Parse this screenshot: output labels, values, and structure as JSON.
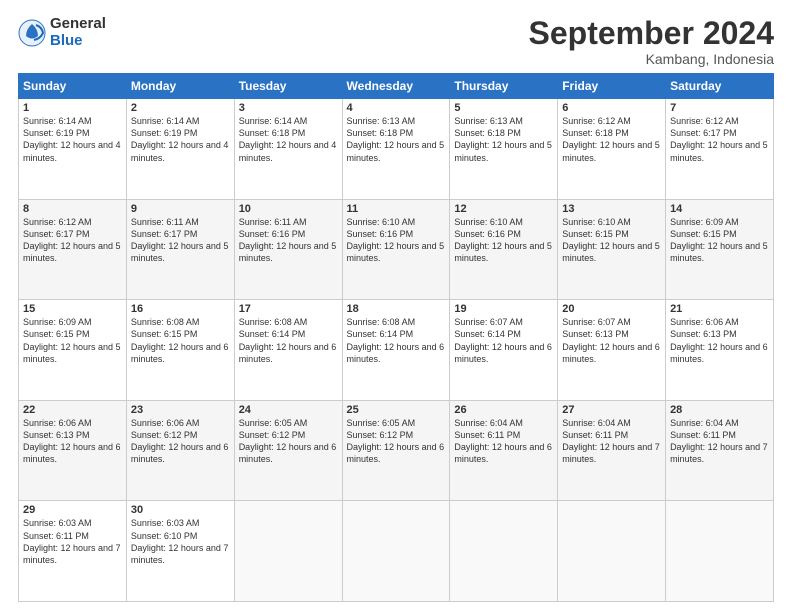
{
  "logo": {
    "general": "General",
    "blue": "Blue"
  },
  "title": "September 2024",
  "location": "Kambang, Indonesia",
  "days_header": [
    "Sunday",
    "Monday",
    "Tuesday",
    "Wednesday",
    "Thursday",
    "Friday",
    "Saturday"
  ],
  "weeks": [
    [
      {
        "day": "1",
        "sunrise": "6:14 AM",
        "sunset": "6:19 PM",
        "daylight": "12 hours and 4 minutes."
      },
      {
        "day": "2",
        "sunrise": "6:14 AM",
        "sunset": "6:19 PM",
        "daylight": "12 hours and 4 minutes."
      },
      {
        "day": "3",
        "sunrise": "6:14 AM",
        "sunset": "6:18 PM",
        "daylight": "12 hours and 4 minutes."
      },
      {
        "day": "4",
        "sunrise": "6:13 AM",
        "sunset": "6:18 PM",
        "daylight": "12 hours and 5 minutes."
      },
      {
        "day": "5",
        "sunrise": "6:13 AM",
        "sunset": "6:18 PM",
        "daylight": "12 hours and 5 minutes."
      },
      {
        "day": "6",
        "sunrise": "6:12 AM",
        "sunset": "6:18 PM",
        "daylight": "12 hours and 5 minutes."
      },
      {
        "day": "7",
        "sunrise": "6:12 AM",
        "sunset": "6:17 PM",
        "daylight": "12 hours and 5 minutes."
      }
    ],
    [
      {
        "day": "8",
        "sunrise": "6:12 AM",
        "sunset": "6:17 PM",
        "daylight": "12 hours and 5 minutes."
      },
      {
        "day": "9",
        "sunrise": "6:11 AM",
        "sunset": "6:17 PM",
        "daylight": "12 hours and 5 minutes."
      },
      {
        "day": "10",
        "sunrise": "6:11 AM",
        "sunset": "6:16 PM",
        "daylight": "12 hours and 5 minutes."
      },
      {
        "day": "11",
        "sunrise": "6:10 AM",
        "sunset": "6:16 PM",
        "daylight": "12 hours and 5 minutes."
      },
      {
        "day": "12",
        "sunrise": "6:10 AM",
        "sunset": "6:16 PM",
        "daylight": "12 hours and 5 minutes."
      },
      {
        "day": "13",
        "sunrise": "6:10 AM",
        "sunset": "6:15 PM",
        "daylight": "12 hours and 5 minutes."
      },
      {
        "day": "14",
        "sunrise": "6:09 AM",
        "sunset": "6:15 PM",
        "daylight": "12 hours and 5 minutes."
      }
    ],
    [
      {
        "day": "15",
        "sunrise": "6:09 AM",
        "sunset": "6:15 PM",
        "daylight": "12 hours and 5 minutes."
      },
      {
        "day": "16",
        "sunrise": "6:08 AM",
        "sunset": "6:15 PM",
        "daylight": "12 hours and 6 minutes."
      },
      {
        "day": "17",
        "sunrise": "6:08 AM",
        "sunset": "6:14 PM",
        "daylight": "12 hours and 6 minutes."
      },
      {
        "day": "18",
        "sunrise": "6:08 AM",
        "sunset": "6:14 PM",
        "daylight": "12 hours and 6 minutes."
      },
      {
        "day": "19",
        "sunrise": "6:07 AM",
        "sunset": "6:14 PM",
        "daylight": "12 hours and 6 minutes."
      },
      {
        "day": "20",
        "sunrise": "6:07 AM",
        "sunset": "6:13 PM",
        "daylight": "12 hours and 6 minutes."
      },
      {
        "day": "21",
        "sunrise": "6:06 AM",
        "sunset": "6:13 PM",
        "daylight": "12 hours and 6 minutes."
      }
    ],
    [
      {
        "day": "22",
        "sunrise": "6:06 AM",
        "sunset": "6:13 PM",
        "daylight": "12 hours and 6 minutes."
      },
      {
        "day": "23",
        "sunrise": "6:06 AM",
        "sunset": "6:12 PM",
        "daylight": "12 hours and 6 minutes."
      },
      {
        "day": "24",
        "sunrise": "6:05 AM",
        "sunset": "6:12 PM",
        "daylight": "12 hours and 6 minutes."
      },
      {
        "day": "25",
        "sunrise": "6:05 AM",
        "sunset": "6:12 PM",
        "daylight": "12 hours and 6 minutes."
      },
      {
        "day": "26",
        "sunrise": "6:04 AM",
        "sunset": "6:11 PM",
        "daylight": "12 hours and 6 minutes."
      },
      {
        "day": "27",
        "sunrise": "6:04 AM",
        "sunset": "6:11 PM",
        "daylight": "12 hours and 7 minutes."
      },
      {
        "day": "28",
        "sunrise": "6:04 AM",
        "sunset": "6:11 PM",
        "daylight": "12 hours and 7 minutes."
      }
    ],
    [
      {
        "day": "29",
        "sunrise": "6:03 AM",
        "sunset": "6:11 PM",
        "daylight": "12 hours and 7 minutes."
      },
      {
        "day": "30",
        "sunrise": "6:03 AM",
        "sunset": "6:10 PM",
        "daylight": "12 hours and 7 minutes."
      },
      null,
      null,
      null,
      null,
      null
    ]
  ]
}
